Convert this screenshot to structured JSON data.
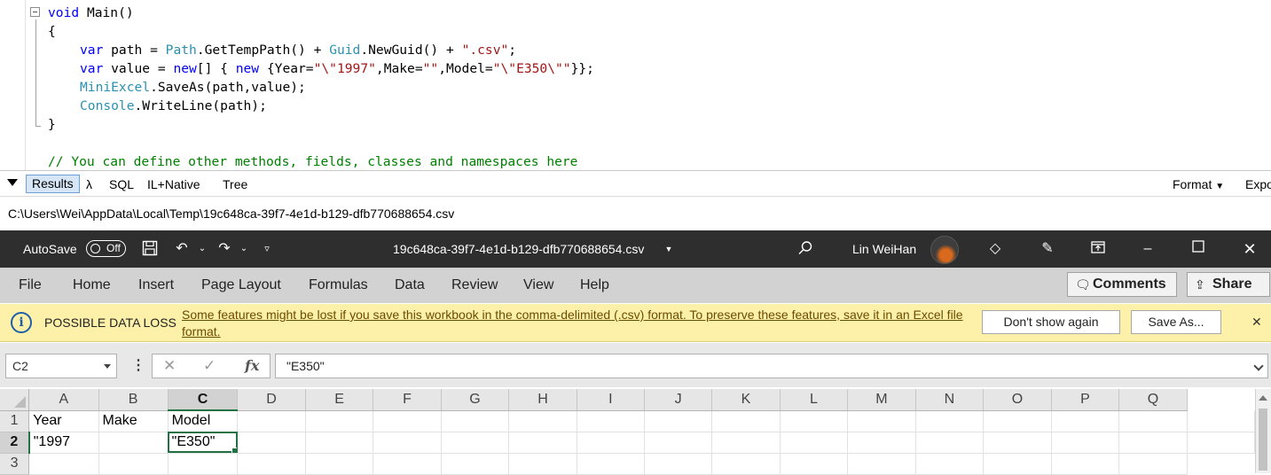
{
  "editor": {
    "lines": [
      [
        "void Main()"
      ],
      [
        "{"
      ],
      [
        "var path = Path.GetTempPath() + Guid.NewGuid() + \".csv\";"
      ],
      [
        "var value = new[] { new {Year=\"\\\"1997\",Make=\"\",Model=\"\\\"E350\\\"\"}};"
      ],
      [
        "MiniExcel.SaveAs(path,value);"
      ],
      [
        "Console.WriteLine(path);"
      ],
      [
        "}"
      ],
      [
        "// You can define other methods, fields, classes and namespaces here"
      ]
    ]
  },
  "results_bar": {
    "tabs": [
      "Results",
      "λ",
      "SQL",
      "IL+Native",
      "Tree"
    ],
    "format_label": "Format",
    "export_label": "Expo"
  },
  "output_path": "C:\\Users\\Wei\\AppData\\Local\\Temp\\19c648ca-39f7-4e1d-b129-dfb770688654.csv",
  "excel": {
    "autosave_label": "AutoSave",
    "autosave_state": "Off",
    "filename": "19c648ca-39f7-4e1d-b129-dfb770688654.csv",
    "user_name": "Lin WeiHan",
    "menu": [
      "File",
      "Home",
      "Insert",
      "Page Layout",
      "Formulas",
      "Data",
      "Review",
      "View",
      "Help"
    ],
    "comments_label": "Comments",
    "share_label": "Share",
    "infobar": {
      "title": "POSSIBLE DATA LOSS",
      "message": "Some features might be lost if you save this workbook in the comma-delimited (.csv) format. To preserve these features, save it in an Excel file format.",
      "dont_show_label": "Don't show again",
      "save_as_label": "Save As..."
    },
    "namebox": "C2",
    "formula": "\"E350\"",
    "columns": [
      "A",
      "B",
      "C",
      "D",
      "E",
      "F",
      "G",
      "H",
      "I",
      "J",
      "K",
      "L",
      "M",
      "N",
      "O",
      "P",
      "Q"
    ],
    "selected_column": "C",
    "selected_row": "2",
    "rows": [
      {
        "num": "1",
        "cells": [
          "Year",
          "Make",
          "Model"
        ]
      },
      {
        "num": "2",
        "cells": [
          "\"1997",
          "",
          "\"E350\""
        ]
      },
      {
        "num": "3",
        "cells": [
          "",
          "",
          ""
        ]
      }
    ],
    "colors": {
      "accent": "#217346",
      "titlebar": "#2e2e2e",
      "infobar": "#fdf0a8"
    }
  }
}
